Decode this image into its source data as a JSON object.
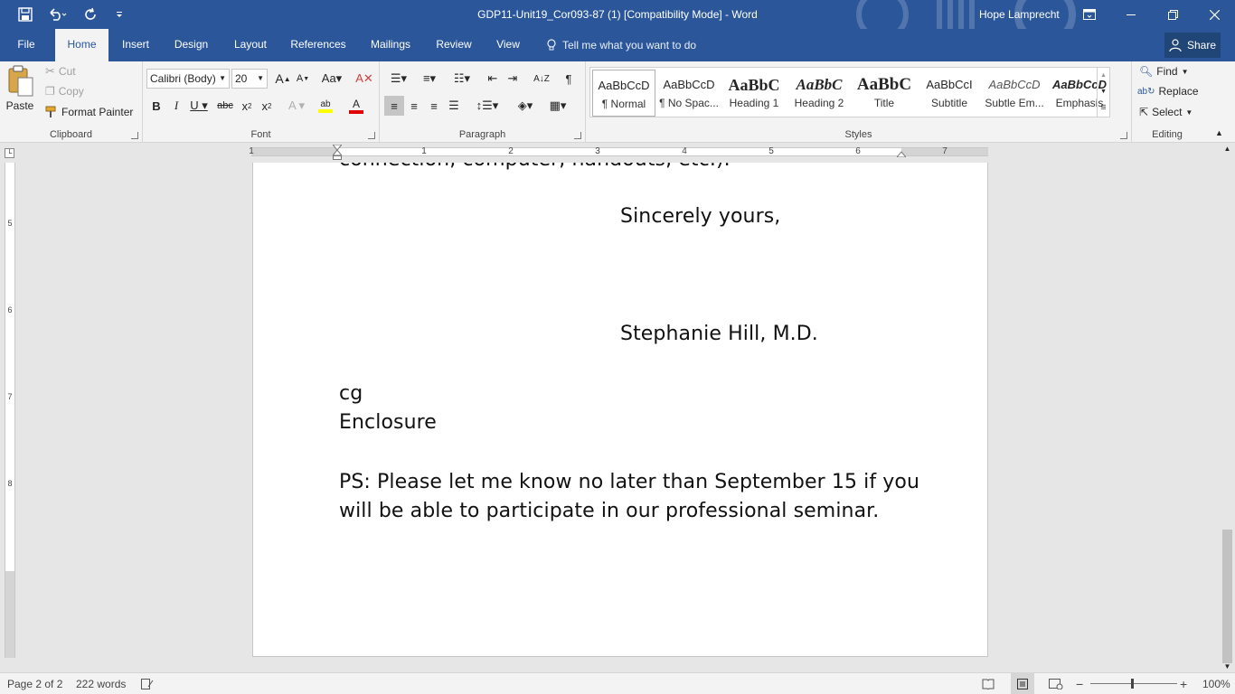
{
  "titlebar": {
    "title": "GDP11-Unit19_Cor093-87 (1) [Compatibility Mode]  -  Word",
    "user": "Hope Lamprecht"
  },
  "tabs": [
    "File",
    "Home",
    "Insert",
    "Design",
    "Layout",
    "References",
    "Mailings",
    "Review",
    "View"
  ],
  "active_tab": "Home",
  "tellme": "Tell me what you want to do",
  "share": "Share",
  "clipboard": {
    "paste": "Paste",
    "cut": "Cut",
    "copy": "Copy",
    "format_painter": "Format Painter",
    "label": "Clipboard"
  },
  "font": {
    "name": "Calibri (Body)",
    "size": "20",
    "label": "Font"
  },
  "paragraph": {
    "label": "Paragraph"
  },
  "styles": {
    "label": "Styles",
    "items": [
      {
        "preview": "AaBbCcD",
        "name": "¶ Normal"
      },
      {
        "preview": "AaBbCcD",
        "name": "¶ No Spac..."
      },
      {
        "preview": "AaBbC",
        "name": "Heading 1"
      },
      {
        "preview": "AaBbC",
        "name": "Heading 2"
      },
      {
        "preview": "AaBbC",
        "name": "Title"
      },
      {
        "preview": "AaBbCcI",
        "name": "Subtitle"
      },
      {
        "preview": "AaBbCcD",
        "name": "Subtle Em..."
      },
      {
        "preview": "AaBbCcD",
        "name": "Emphasis"
      }
    ]
  },
  "editing": {
    "find": "Find",
    "replace": "Replace",
    "select": "Select",
    "label": "Editing"
  },
  "ruler": {
    "numbers": [
      "1",
      "1",
      "2",
      "3",
      "4",
      "5",
      "6",
      "7"
    ]
  },
  "vruler": {
    "numbers": [
      "5",
      "6",
      "7",
      "8"
    ]
  },
  "document": {
    "cut_line": "connection, computer, handouts, etc.).",
    "closing": "Sincerely yours,",
    "signer": "Stephanie Hill, M.D.",
    "initials": "cg",
    "enclosure": "Enclosure",
    "ps_line1": "PS: Please let me know no later than September 15 if you",
    "ps_line2": "will be able to participate in our professional seminar."
  },
  "status": {
    "page": "Page 2 of 2",
    "words": "222 words",
    "zoom": "100%"
  },
  "colors": {
    "accent": "#2b579a",
    "highlight": "#ffff00",
    "font_color": "#e00000"
  }
}
